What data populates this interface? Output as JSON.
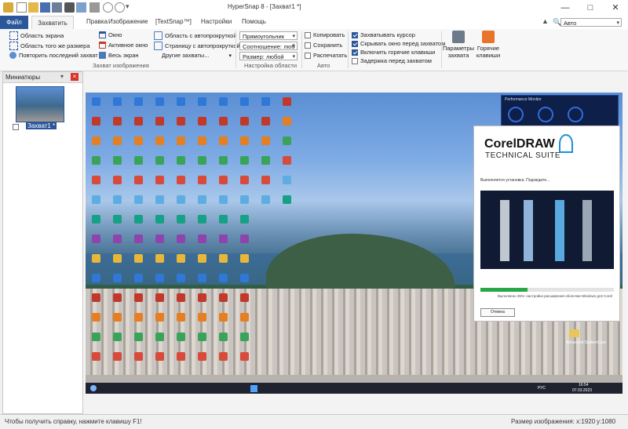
{
  "window": {
    "title": "HyperSnap 8 - [Захват1 *]",
    "minimize": "—",
    "maximize": "□",
    "close": "✕"
  },
  "menu": {
    "tabs": [
      "Файл",
      "Захватить",
      "Правка",
      "Изображение",
      "[TextSnap™]",
      "Настройки",
      "Помощь"
    ],
    "zoom_value": "Авто"
  },
  "ribbon": {
    "capture_group": {
      "items": [
        "Область экрана",
        "Область того же размера",
        "Повторить последний захват",
        "Окно",
        "Активное окно",
        "Весь экран",
        "Область с автопрокруткой",
        "Страницу с автопрокруткой",
        "Другие захваты..."
      ],
      "label": "Захват изображения"
    },
    "region_group": {
      "shape": "Прямоугольник",
      "ratio": "Соотношение: люб",
      "size": "Размер: любой",
      "label": "Настройка области"
    },
    "auto_group": {
      "items": [
        "Копировать",
        "Сохранить",
        "Распечатать"
      ],
      "label": "Авто"
    },
    "options_group": {
      "items": [
        "Захватывать курсор",
        "Скрывать окно перед захватом",
        "Включить горячие клавиши",
        "Задержка перед захватом"
      ],
      "checked": [
        true,
        true,
        true,
        false
      ]
    },
    "big_buttons": {
      "params_line1": "Параметры",
      "params_line2": "захвата",
      "hotkeys_line1": "Горячие",
      "hotkeys_line2": "клавиши"
    }
  },
  "thumbnails": {
    "title": "Миниатюры",
    "item_label": "Захват1 *"
  },
  "screenshot": {
    "installer_brand": "CorelDRAW",
    "installer_suite": "TECHNICAL SUITE",
    "installer_status": "Выполняется установка. Подождите...",
    "installer_progress_text": "Выполнено 35%: настройка расширения оболочки Windows для Corel",
    "installer_progress": 0.35,
    "installer_cancel": "Отмена",
    "perf_title": "Performance Monitor",
    "tray_time": "16:54",
    "tray_date": "07.03.2023",
    "tray_lang": "РУС",
    "folder_label": "Advanced SystemCare"
  },
  "status": {
    "help": "Чтобы получить справку, нажмите клавишу F1!",
    "size_label": "Размер изображения: x:1920",
    "y_value": "y:1080"
  },
  "colors": {
    "accent": "#2b579a",
    "ribbon_bg": "#f7f7f7"
  }
}
